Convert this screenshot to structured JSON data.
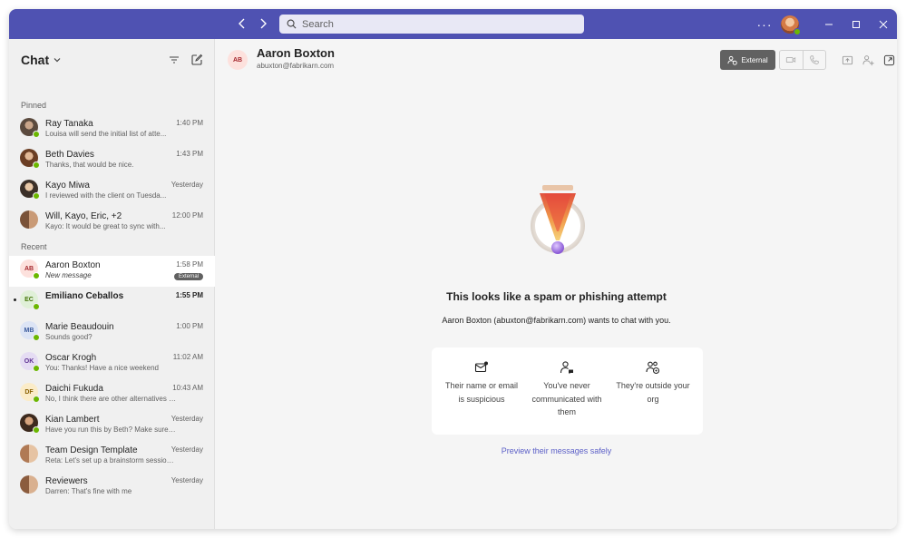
{
  "titlebar": {
    "search_placeholder": "Search",
    "more_label": "···"
  },
  "sidebar": {
    "title": "Chat",
    "pinned_label": "Pinned",
    "recent_label": "Recent",
    "pinned": [
      {
        "name": "Ray Tanaka",
        "time": "1:40 PM",
        "preview": "Louisa will send the initial list of atte...",
        "initials": ""
      },
      {
        "name": "Beth Davies",
        "time": "1:43 PM",
        "preview": "Thanks, that would be nice.",
        "initials": ""
      },
      {
        "name": "Kayo Miwa",
        "time": "Yesterday",
        "preview": "I reviewed with the client on Tuesda...",
        "initials": ""
      },
      {
        "name": "Will, Kayo, Eric, +2",
        "time": "12:00 PM",
        "preview": "Kayo: It would be great to sync with...",
        "initials": ""
      }
    ],
    "recent": [
      {
        "name": "Aaron Boxton",
        "time": "1:58 PM",
        "preview": "New message",
        "initials": "AB",
        "badge": "External"
      },
      {
        "name": "Emiliano Ceballos",
        "time": "1:55 PM",
        "preview": "",
        "initials": "EC"
      },
      {
        "name": "Marie Beaudouin",
        "time": "1:00 PM",
        "preview": "Sounds good?",
        "initials": "MB"
      },
      {
        "name": "Oscar Krogh",
        "time": "11:02 AM",
        "preview": "You: Thanks! Have a nice weekend",
        "initials": "OK"
      },
      {
        "name": "Daichi Fukuda",
        "time": "10:43 AM",
        "preview": "No, I think there are other alternatives we c...",
        "initials": "DF"
      },
      {
        "name": "Kian Lambert",
        "time": "Yesterday",
        "preview": "Have you run this by Beth? Make sure she i...",
        "initials": ""
      },
      {
        "name": "Team Design Template",
        "time": "Yesterday",
        "preview": "Reta: Let's set up a brainstorm session for...",
        "initials": ""
      },
      {
        "name": "Reviewers",
        "time": "Yesterday",
        "preview": "Darren: That's fine with me",
        "initials": ""
      }
    ]
  },
  "main": {
    "contact_initials": "AB",
    "contact_name": "Aaron Boxton",
    "contact_email": "abuxton@fabrikarn.com",
    "external_label": "External",
    "warning_title": "This looks like a spam or phishing attempt",
    "warning_subtitle": "Aaron Boxton (abuxton@fabrikarn.com) wants to chat with you.",
    "reasons": [
      {
        "text": "Their name or email is suspicious",
        "icon": "mail-alert-icon"
      },
      {
        "text": "You've never communicated with them",
        "icon": "person-chat-icon"
      },
      {
        "text": "They're outside your org",
        "icon": "people-external-icon"
      }
    ],
    "preview_link": "Preview their messages safely"
  },
  "colors": {
    "titlebar": "#4f52b2",
    "link": "#5b5fc7",
    "presence": "#6bb700"
  }
}
